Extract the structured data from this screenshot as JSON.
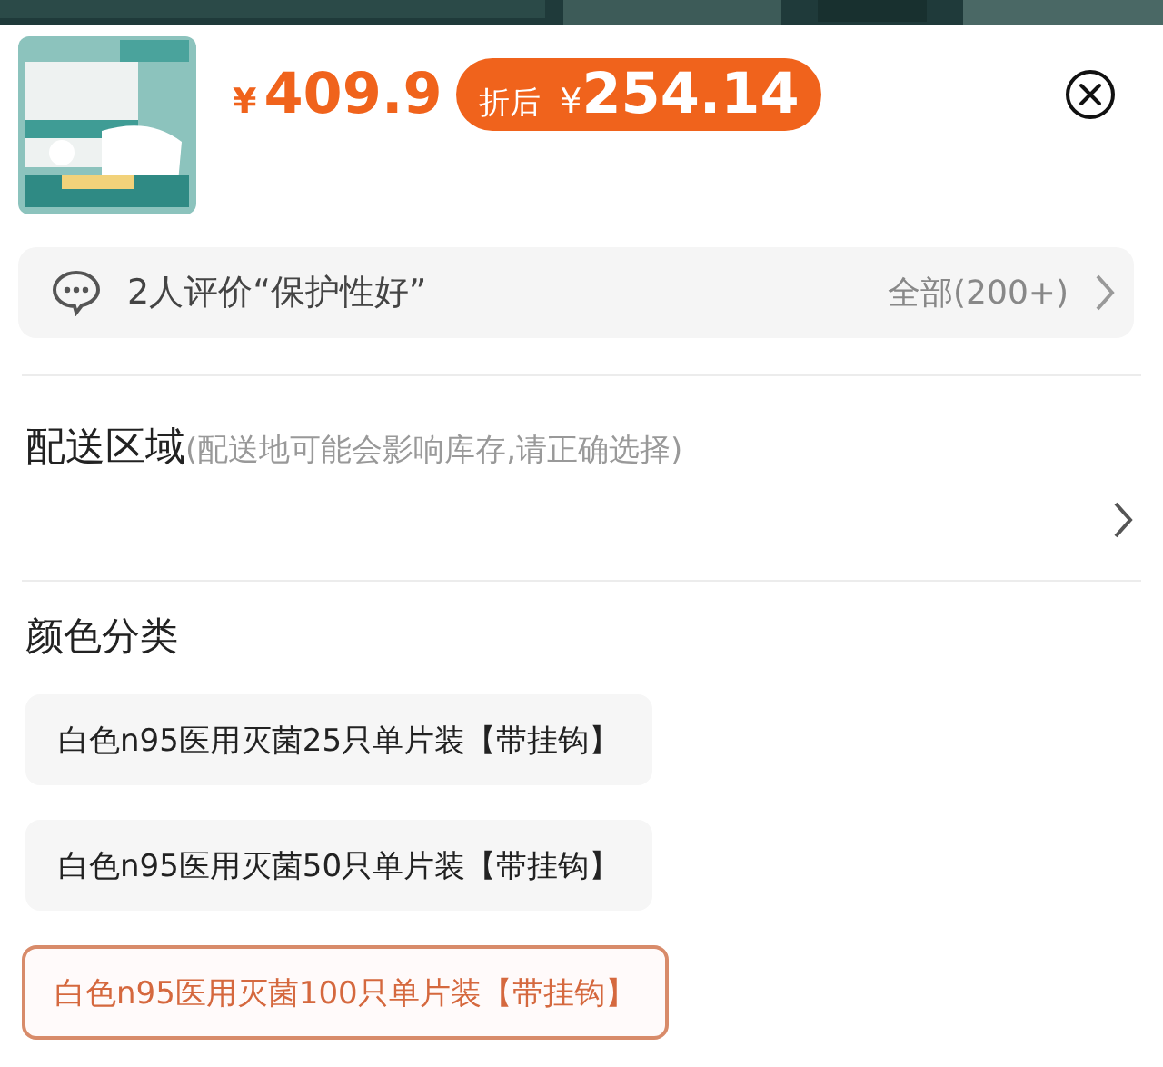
{
  "product": {
    "price_symbol": "¥",
    "price": "409.9",
    "discount": {
      "label": "折后",
      "symbol": "¥",
      "price": "254.14"
    }
  },
  "review": {
    "text": "2人评价“保护性好”",
    "all": "全部(200+)"
  },
  "delivery": {
    "title": "配送区域",
    "hint": "(配送地可能会影响库存,请正确选择)"
  },
  "options": {
    "title": "颜色分类",
    "items": [
      {
        "label": "白色n95医用灭菌25只单片装【带挂钩】",
        "selected": false
      },
      {
        "label": "白色n95医用灭菌50只单片装【带挂钩】",
        "selected": false
      },
      {
        "label": "白色n95医用灭菌100只单片装【带挂钩】",
        "selected": true
      }
    ]
  }
}
